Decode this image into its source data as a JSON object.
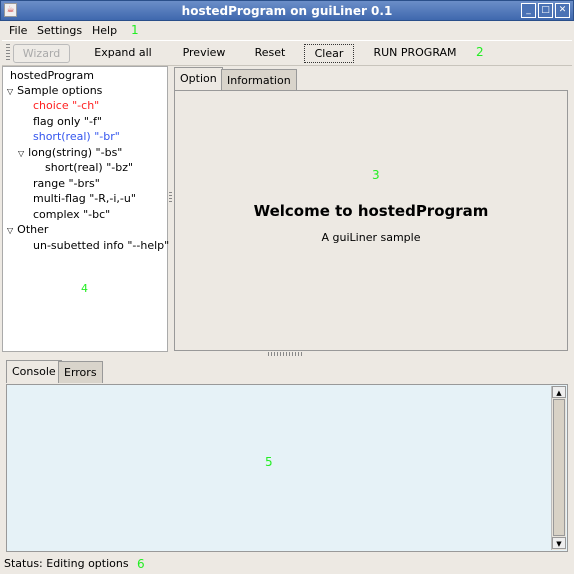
{
  "window": {
    "title": "hostedProgram on guiLiner 0.1",
    "icon": "java-icon",
    "controls": [
      "minimize",
      "maximize",
      "close"
    ]
  },
  "menu": {
    "items": [
      "File",
      "Settings",
      "Help"
    ],
    "marker": "1"
  },
  "toolbar": {
    "wizard": "Wizard",
    "expand_all": "Expand all",
    "preview": "Preview",
    "reset": "Reset",
    "clear": "Clear",
    "run": "RUN  PROGRAM",
    "marker": "2"
  },
  "tree": {
    "root": "hostedProgram",
    "sample": "Sample options",
    "choice": "choice \"-ch\"",
    "flag": "flag only \"-f\"",
    "short_real": "short(real) \"-br\"",
    "long_string": "long(string) \"-bs\"",
    "short_real_nested": "short(real) \"-bz\"",
    "range": "range \"-brs\"",
    "multi": "multi-flag \"-R,-i,-u\"",
    "complex": "complex \"-bc\"",
    "other": "Other",
    "unsubsetted": "un-subetted info \"--help\"",
    "marker": "4",
    "colors": {
      "choice": "#ff2020",
      "short_real": "#3355ee"
    }
  },
  "right": {
    "tabs": [
      "Option",
      "Information"
    ],
    "welcome": "Welcome to hostedProgram",
    "subtitle": "A guiLiner sample",
    "marker": "3"
  },
  "bottom": {
    "tabs": [
      "Console",
      "Errors"
    ],
    "marker": "5"
  },
  "status": {
    "text": "Status: Editing options",
    "marker": "6"
  }
}
